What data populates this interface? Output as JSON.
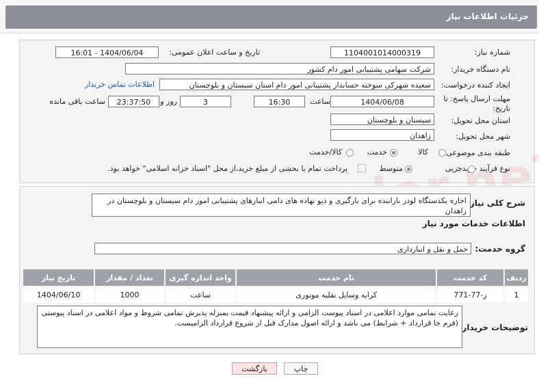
{
  "header": {
    "title": "جزئیات اطلاعات نیاز"
  },
  "form": {
    "need_number_label": "شماره نیاز:",
    "need_number": "1104001014000319",
    "announce_label": "تاریخ و ساعت اعلان عمومی:",
    "announce_value": "1404/06/04 - 16:01",
    "buyer_org_label": "نام دستگاه خریدار:",
    "buyer_org": "شرکت سهامی پشتیبانی امور دام کشور",
    "requester_label": "ایجاد کننده درخواست:",
    "requester": "سعیده شهرکی سوخته حسابدار پشتیبانی امور دام استان سیستان و بلوچستان",
    "contact_link": "اطلاعات تماس خریدار",
    "deadline_label_1": "مهلت ارسال پاسخ: تا",
    "deadline_label_2": "تاریخ:",
    "deadline_date": "1404/06/08",
    "time_label": "ساعت",
    "deadline_time": "16:30",
    "days_value": "3",
    "days_label": "روز و",
    "remaining_value": "23:37:50",
    "remaining_label": "ساعت باقی مانده",
    "province_label": "استان محل تحویل:",
    "province": "سیستان و بلوچستان",
    "city_label": "شهر محل تحویل:",
    "city": "زاهدان",
    "category_label": "طبقه بندی موضوعی:",
    "category_options": [
      "کالا",
      "خدمت",
      "کالا/خدمت"
    ],
    "category_selected": "خدمت",
    "process_label": "نوع فرآیند خرید :",
    "process_options": [
      "جزیی",
      "متوسط"
    ],
    "process_selected": "متوسط",
    "payment_note": "پرداخت تمام یا بخشی از مبلغ خرید،از محل \"اسناد خزانه اسلامی\" خواهد بود."
  },
  "need": {
    "summary_label": "شرح کلی نیاز:",
    "summary": "اجاره یکدستگاه لودر باراننده برای بارگیری و دپو نهاده های دامی انبارهای پشتیبانی امور دام سیستان و بلوچستان در زاهدان",
    "services_title": "اطلاعات خدمات مورد نیاز",
    "group_label": "گروه خدمت:",
    "group_value": "حمل و نقل و انبارداری",
    "table": {
      "headers": [
        "ردیف",
        "کد خدمت",
        "نام خدمت",
        "واحد اندازه گیری",
        "تعداد / مقدار",
        "تاریخ نیاز"
      ],
      "rows": [
        [
          "1",
          "ز-77-771",
          "کرایه وسایل نقلیه موتوری",
          "ساعت",
          "1000",
          "1404/06/10"
        ]
      ]
    },
    "buyer_notes_label": "توضیحات خریدار:",
    "buyer_notes": "رعایت تمامی موارد اعلامی در اسناد پیوست الزامی و ارائه پیشنهاد قیمت بمنزله پذیرش تمامی شروط و مواد اعلامی در اسناد پیوستی (فرم خا قرارداد + شرایط) می باشد و ارائه اصول مدارک قبل از شروع قرارداد الزامیست."
  },
  "buttons": {
    "print": "چاپ",
    "back": "بازگشت"
  },
  "watermark": "AriaTender.neT"
}
